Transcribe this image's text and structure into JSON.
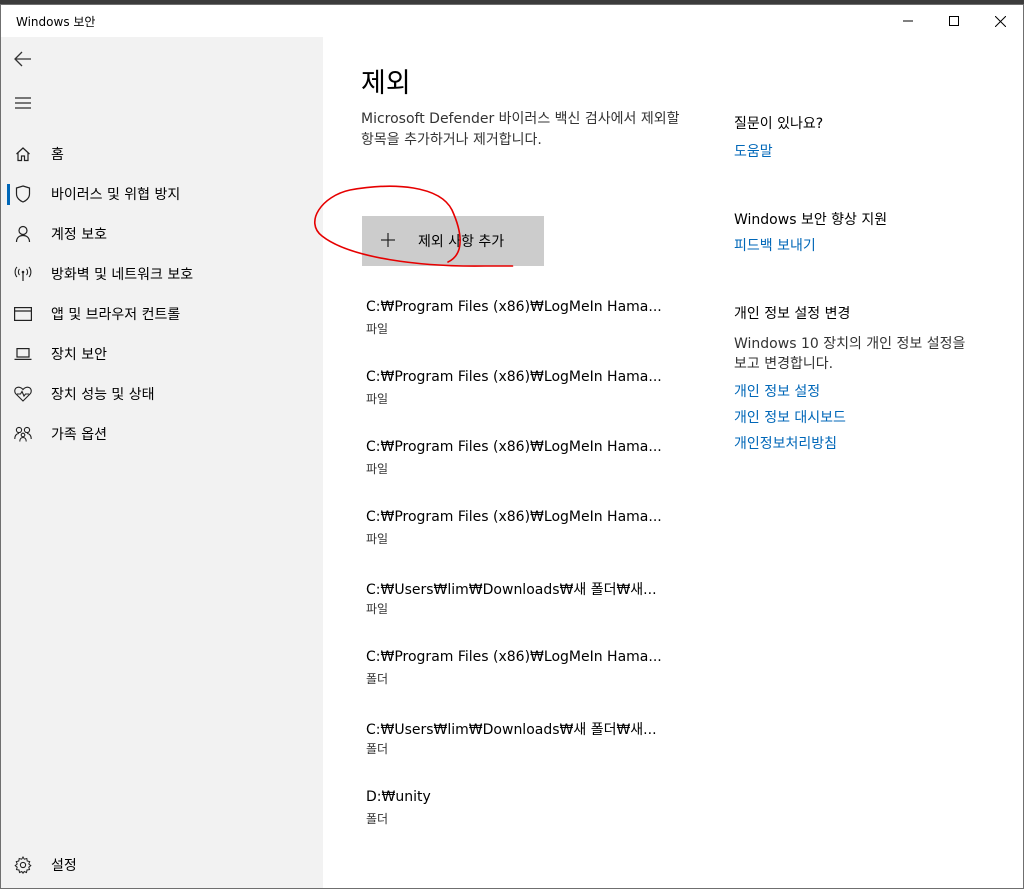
{
  "window": {
    "title": "Windows 보안"
  },
  "sidebar": {
    "items": [
      {
        "label": "홈",
        "icon": "home-icon"
      },
      {
        "label": "바이러스 및 위협 방지",
        "icon": "shield-icon",
        "selected": true
      },
      {
        "label": "계정 보호",
        "icon": "person-icon"
      },
      {
        "label": "방화벽 및 네트워크 보호",
        "icon": "antenna-icon"
      },
      {
        "label": "앱 및 브라우저 컨트롤",
        "icon": "app-window-icon"
      },
      {
        "label": "장치 보안",
        "icon": "laptop-icon"
      },
      {
        "label": "장치 성능 및 상태",
        "icon": "heart-pulse-icon"
      },
      {
        "label": "가족 옵션",
        "icon": "family-icon"
      }
    ],
    "settings_label": "설정"
  },
  "main": {
    "title": "제외",
    "description": "Microsoft Defender 바이러스 백신 검사에서 제외할 항목을 추가하거나 제거합니다.",
    "add_button_label": "제외 사항 추가",
    "exclusions": [
      {
        "path": "C:₩Program Files (x86)₩LogMeIn Hama...",
        "type": "파일"
      },
      {
        "path": "C:₩Program Files (x86)₩LogMeIn Hama...",
        "type": "파일"
      },
      {
        "path": "C:₩Program Files (x86)₩LogMeIn Hama...",
        "type": "파일"
      },
      {
        "path": "C:₩Program Files (x86)₩LogMeIn Hama...",
        "type": "파일"
      },
      {
        "path": "C:₩Users₩lim₩Downloads₩새 폴더₩새...",
        "type": "파일"
      },
      {
        "path": "C:₩Program Files (x86)₩LogMeIn Hama...",
        "type": "폴더"
      },
      {
        "path": "C:₩Users₩lim₩Downloads₩새 폴더₩새...",
        "type": "폴더"
      },
      {
        "path": "D:₩unity",
        "type": "폴더"
      }
    ]
  },
  "aside": {
    "help_heading": "질문이 있나요?",
    "help_link": "도움말",
    "improve_heading": "Windows 보안 향상 지원",
    "feedback_link": "피드백 보내기",
    "privacy_heading": "개인 정보 설정 변경",
    "privacy_text": "Windows 10 장치의 개인 정보 설정을 보고 변경합니다.",
    "privacy_links": [
      "개인 정보 설정",
      "개인 정보 대시보드",
      "개인정보처리방침"
    ]
  },
  "colors": {
    "accent": "#0067b8",
    "sidebar_bg": "#f2f2f2",
    "button_bg": "#cccccc",
    "annotation": "#e60000"
  }
}
